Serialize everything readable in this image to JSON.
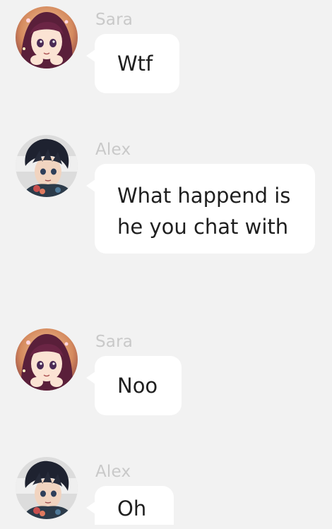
{
  "messages": [
    {
      "sender": "Sara",
      "text": "Wtf"
    },
    {
      "sender": "Alex",
      "text": "What happend is\nhe you chat with"
    },
    {
      "sender": "Sara",
      "text": "Noo"
    },
    {
      "sender": "Alex",
      "text": "Oh"
    }
  ],
  "avatars": {
    "sara": {
      "icon": "anime-girl-avatar",
      "hair": "#5a1f3a",
      "bg": "#e8b08a"
    },
    "alex": {
      "icon": "anime-boy-avatar",
      "hair": "#1e2230",
      "bg": "#d9d9d9"
    }
  }
}
